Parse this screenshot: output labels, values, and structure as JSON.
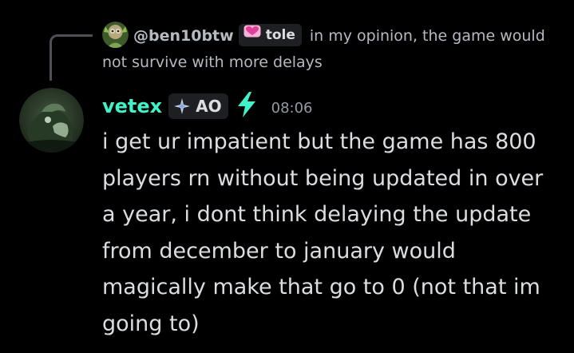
{
  "reply": {
    "username": "@ben10btw",
    "tag": "tole",
    "text": "in my opinion, the game would not survive with more delays"
  },
  "message": {
    "username": "vetex",
    "clan_tag": "AO",
    "timestamp": "08:06",
    "text": "i get ur impatient but the game has 800 players rn without being updated in over a year, i dont think delaying the update from december to january would magically make that go to 0 (not that im going to)"
  },
  "colors": {
    "background": "#000000",
    "username": "#3ef3c8",
    "text": "#dbdee1",
    "muted": "#949ba4",
    "tag_bg": "#1e1f22",
    "heart": "#f47fbf",
    "bolt": "#3ef3c8"
  },
  "icons": {
    "reply_avatar": "reply-avatar-icon",
    "tag_heart": "heart-icon",
    "clan_tag_icon": "diamond-sparkle-icon",
    "bolt": "lightning-bolt-icon",
    "main_avatar": "avatar"
  }
}
